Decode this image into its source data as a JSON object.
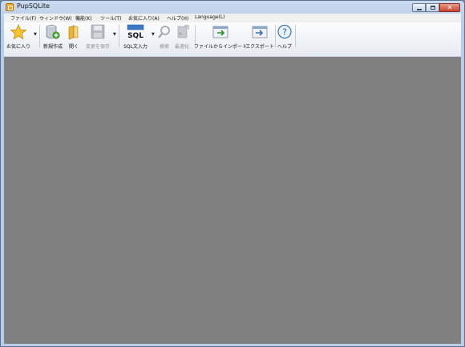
{
  "window": {
    "title": "PupSQLite"
  },
  "menu": {
    "file": "ファイル(F)",
    "window": "ウィンドウ(W)",
    "function": "機能(K)",
    "tools": "ツール(T)",
    "favorites": "お気に入り(A)",
    "help": "ヘルプ(H)",
    "language": "Language(L)"
  },
  "toolbar": {
    "favorites": "お気に入り",
    "new": "新規作成",
    "open": "開く",
    "save": "変更を保存",
    "sql": "SQL文入力",
    "search": "検索",
    "optimize": "最適化",
    "import": "ファイルからインポート",
    "export": "エクスポート",
    "help": "ヘルプ"
  },
  "colors": {
    "client_background": "#808080",
    "title_bar": "#c9daf0"
  }
}
